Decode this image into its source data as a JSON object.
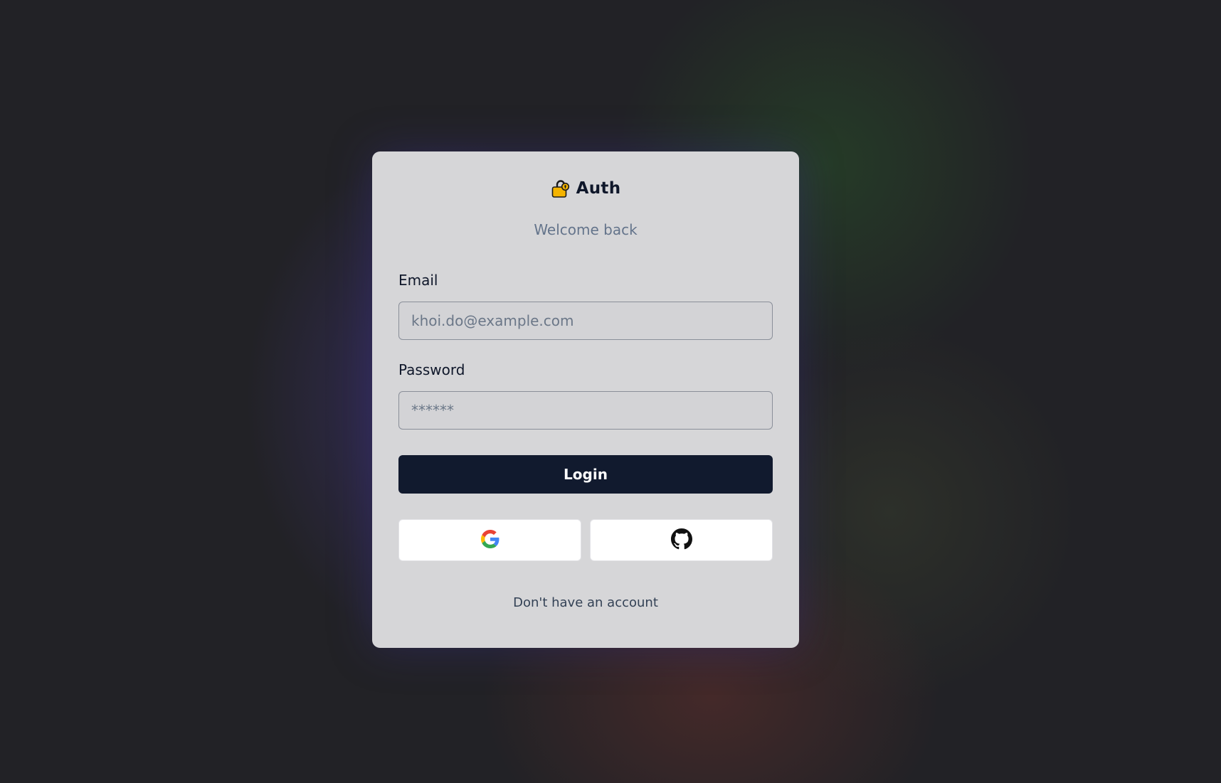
{
  "brand": {
    "title": "Auth",
    "icon": "lock-icon"
  },
  "subtitle": "Welcome back",
  "form": {
    "email_label": "Email",
    "email_value": "",
    "email_placeholder": "khoi.do@example.com",
    "password_label": "Password",
    "password_value": "",
    "password_placeholder": "******",
    "login_label": "Login"
  },
  "oauth": [
    {
      "provider": "Google",
      "icon": "google-icon"
    },
    {
      "provider": "GitHub",
      "icon": "github-icon"
    }
  ],
  "footer": {
    "signup_text": "Don't have an account"
  },
  "colors": {
    "background": "#222226",
    "card": "#d6d6d8",
    "login_button": "#111a2e",
    "subtitle": "#64748b",
    "lock_body": "#f5b400"
  }
}
